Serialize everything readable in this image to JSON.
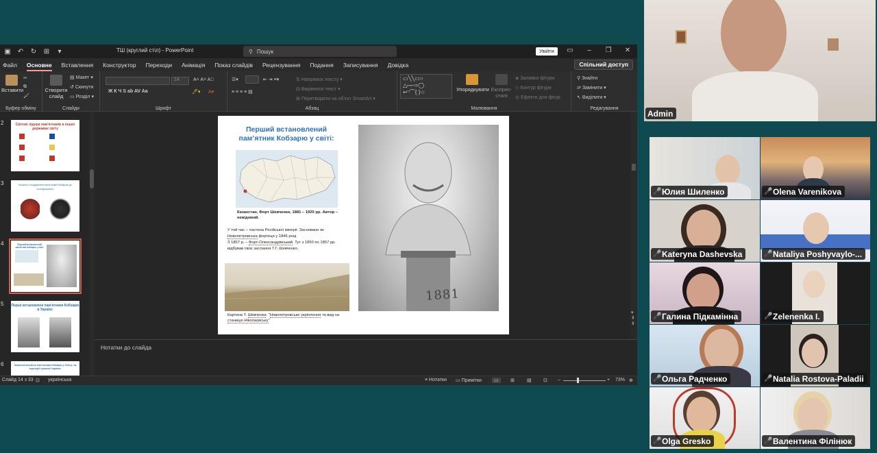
{
  "powerpoint": {
    "window_title": "ТШ (круглий стіл)  -  PowerPoint",
    "search_placeholder": "Пошук",
    "sign_in": "Увійти",
    "share": "Спільний доступ",
    "tabs": [
      "Файл",
      "Основне",
      "Вставлення",
      "Конструктор",
      "Переходи",
      "Анімація",
      "Показ слайдів",
      "Рецензування",
      "Подання",
      "Записування",
      "Довідка"
    ],
    "active_tab": "Основне",
    "ribbon": {
      "paste": "Вставити",
      "new_slide": "Створити слайд",
      "layout": "Макет",
      "reset": "Скинути",
      "section": "Розділ",
      "font_size": "14",
      "text_direction": "Напрямок тексту",
      "align_text": "Вирівняти текст",
      "convert_smartart": "Перетворити на об'єкт SmartArt",
      "arrange": "Упорядкувати",
      "quick_styles": "Експрес-стилі",
      "shape_fill": "Заливка фігури",
      "shape_outline": "Контур фігури",
      "shape_effects": "Ефекти для фігур",
      "find": "Знайти",
      "replace": "Замінити",
      "select": "Виділити",
      "groups": [
        "Буфер обміну",
        "Слайди",
        "Шрифт",
        "Абзац",
        "Малювання",
        "Редагування"
      ]
    },
    "thumbnails": [
      {
        "number": "2",
        "title": "Світові лідери пам'ятників в інших державах світу"
      },
      {
        "number": "3",
        "title": "Кількість спорудження пам'ятників Кобзареві до сьогоднішнього"
      },
      {
        "number": "4",
        "title": "Перший встановлений пам'ятник Кобзарю у світі"
      },
      {
        "number": "5",
        "title": "Перші встановлені пам'ятники Кобзарю в Україні:"
      },
      {
        "number": "6",
        "title": "Загальна кількість пам'ятників Кобзарю у 1914 р. на території сучасної України:"
      }
    ],
    "slide": {
      "title": "Перший встановлений пам’ятник Кобзарю у світі:",
      "caption_map": "Казахстан, Форт Шевченко, 1881 – 1920 рр. Автор – невідомий.",
      "body_1": "У той час – частина Російської імперії. Засноване як",
      "body_link_1": "Новопетровська",
      "body_2": " фортеця у 1846 році.",
      "body_3": "З 1857 р. – ",
      "body_link_2": "Форт-Олександрівський",
      "body_4": ". Тут з 1850 по 1857 рр. відбував своє заслання Т.Г. Шевченко.",
      "caption_painting_1": "Картина Т. ",
      "caption_painting_link_1": "Шевченка",
      "caption_painting_2": ": \"",
      "caption_painting_link_2": "Новопетровське укріплення",
      "caption_painting_3": " та вид на ",
      "caption_painting_link_3": "станицю Ніколаєвську",
      "caption_painting_4": "\"",
      "bust_year": "1881"
    },
    "notes_placeholder": "Нотатки до слайда",
    "status": {
      "slide_counter": "Слайд 14 з 33",
      "language": "українська",
      "notes": "Нотатки",
      "comments": "Примітки",
      "zoom": "73%",
      "zoom_fraction": 0.73
    }
  },
  "participants": [
    {
      "name": "Admin",
      "muted": false
    },
    {
      "name": "Юлия Шиленко",
      "muted": true
    },
    {
      "name": "Olena Varenikova",
      "muted": true
    },
    {
      "name": "Kateryna Dashevska",
      "muted": true
    },
    {
      "name": "Nataliya Poshyvaylo-...",
      "muted": true
    },
    {
      "name": "Галина Підкамінна",
      "muted": true
    },
    {
      "name": "Zelenenka I.",
      "muted": true
    },
    {
      "name": "Ольга Радченко",
      "muted": true
    },
    {
      "name": "Natalia Rostova-Paladii",
      "muted": true
    },
    {
      "name": "Olga Gresko",
      "muted": true
    },
    {
      "name": "Валентина Філінюк",
      "muted": true
    }
  ],
  "colors": {
    "slide_title": "#2a72c0",
    "mute": "#e33333",
    "selected_thumb": "#d0604a"
  }
}
